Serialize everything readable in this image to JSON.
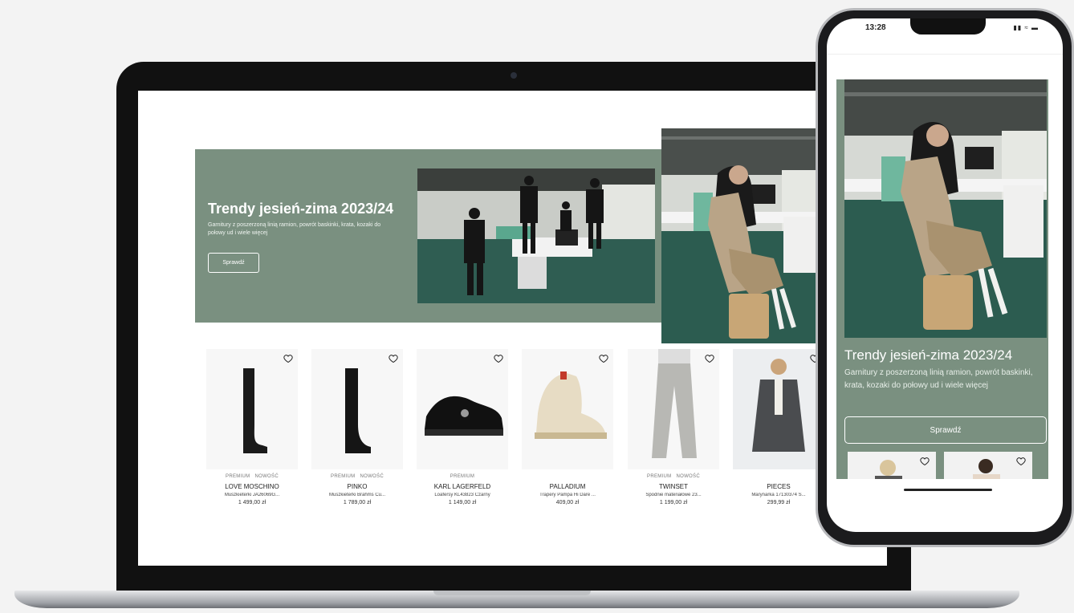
{
  "desktop": {
    "hero": {
      "title": "Trendy jesień-zima 2023/24",
      "subtitle": "Garnitury z poszerzoną linią ramion, powrót baskinki, krata, kozaki do połowy ud i wiele więcej",
      "button": "Sprawdź"
    },
    "products": [
      {
        "badges": [
          "PREMIUM",
          "NOWOŚĆ"
        ],
        "brand": "LOVE MOSCHINO",
        "name": "Muszkieterki JA26069G...",
        "price": "1 499,00 zł",
        "icon": "heart-icon"
      },
      {
        "badges": [
          "PREMIUM",
          "NOWOŚĆ"
        ],
        "brand": "PINKO",
        "name": "Muszkieterki Brahms Cu...",
        "price": "1 789,00 zł",
        "icon": "heart-icon"
      },
      {
        "badges": [
          "PREMIUM"
        ],
        "brand": "KARL LAGERFELD",
        "name": "Loafersy KL43823 Czarny",
        "price": "1 149,00 zł",
        "icon": "heart-icon"
      },
      {
        "badges": [],
        "brand": "PALLADIUM",
        "name": "Trapery Pampa Hi Dare ...",
        "price": "409,00 zł",
        "icon": "heart-icon"
      },
      {
        "badges": [
          "PREMIUM",
          "NOWOŚĆ"
        ],
        "brand": "TWINSET",
        "name": "Spodnie materiałowe 23...",
        "price": "1 199,00 zł",
        "icon": "heart-icon"
      },
      {
        "badges": [],
        "brand": "PIECES",
        "name": "Marynarka 17130374 S...",
        "price": "299,99 zł",
        "icon": "heart-icon"
      }
    ],
    "next_icon": "chevron-right-icon"
  },
  "mobile": {
    "time": "13:28",
    "status_icons": [
      "signal-icon",
      "wifi-icon",
      "battery-icon"
    ],
    "hero": {
      "title": "Trendy jesień-zima 2023/24",
      "subtitle": "Garnitury z poszerzoną linią ramion, powrót baskinki, krata, kozaki do połowy ud i wiele więcej",
      "button": "Sprawdź"
    }
  },
  "colors": {
    "hero_green": "#7a9080",
    "office_floor": "#2e5a4e"
  }
}
